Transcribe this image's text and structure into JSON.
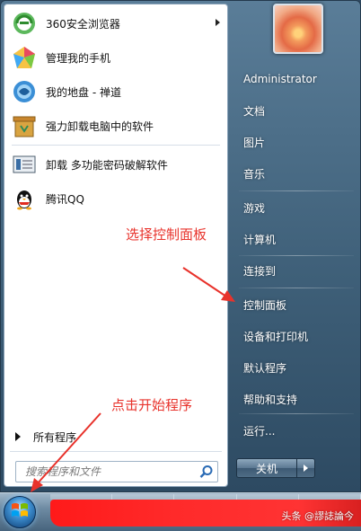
{
  "programs": [
    {
      "label": "360安全浏览器",
      "icon": "360-browser-icon",
      "has_submenu": true
    },
    {
      "label": "管理我的手机",
      "icon": "phone-manager-icon",
      "has_submenu": false
    },
    {
      "label": "我的地盘 - 禅道",
      "icon": "zentao-icon",
      "has_submenu": false
    },
    {
      "label": "强力卸载电脑中的软件",
      "icon": "uninstaller-icon",
      "has_submenu": false
    },
    {
      "label": "卸载 多功能密码破解软件",
      "icon": "uninstall-tool-icon",
      "has_submenu": false
    },
    {
      "label": "腾讯QQ",
      "icon": "qq-icon",
      "has_submenu": false
    }
  ],
  "all_programs": "所有程序",
  "search": {
    "placeholder": "搜索程序和文件"
  },
  "right_panel": {
    "user": "Administrator",
    "items": [
      "文档",
      "图片",
      "音乐",
      "游戏",
      "计算机",
      "连接到",
      "控制面板",
      "设备和打印机",
      "默认程序",
      "帮助和支持",
      "运行..."
    ]
  },
  "shutdown_label": "关机",
  "annotations": {
    "control_panel_hint": "选择控制面板",
    "start_hint": "点击开始程序"
  },
  "watermark": "头条 @謬誌論今",
  "colors": {
    "annotation": "#e8322b",
    "redaction": "#ff2a2a"
  }
}
